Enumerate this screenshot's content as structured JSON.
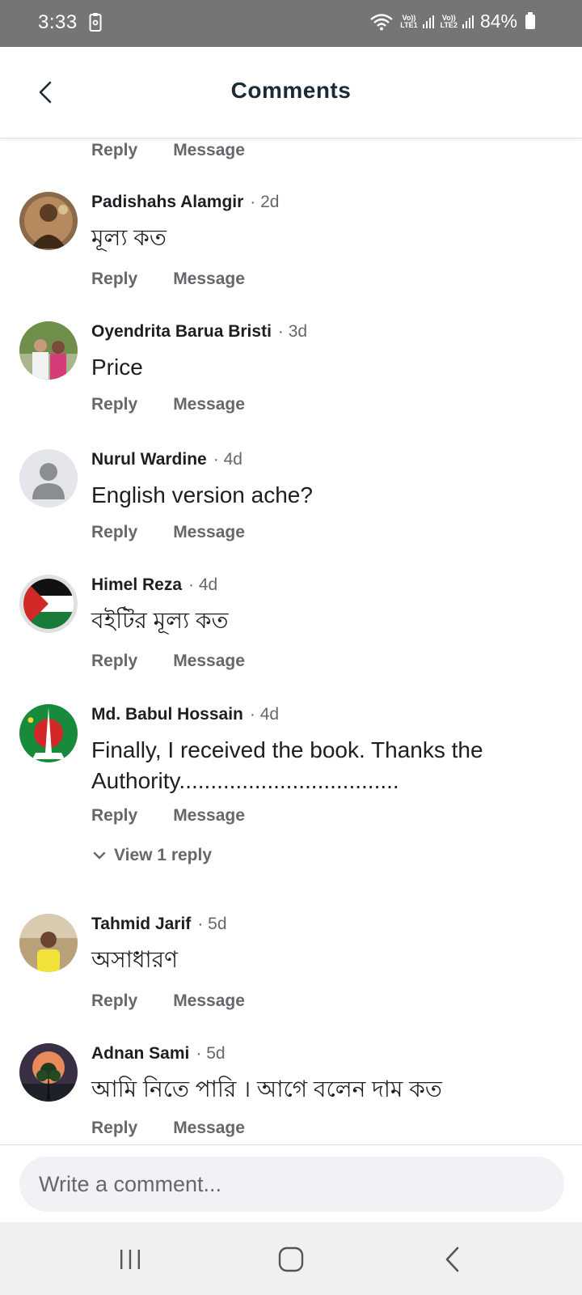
{
  "status_bar": {
    "time": "3:33",
    "sim1_label": "Vo))",
    "sim1_sub": "LTE1",
    "sim2_label": "Vo))",
    "sim2_sub": "LTE2",
    "battery": "84%"
  },
  "header": {
    "title": "Comments"
  },
  "actions": {
    "reply_label": "Reply",
    "message_label": "Message"
  },
  "comments": [
    {
      "name": "Padishahs Alamgir",
      "time": "2d",
      "text": "মূল্য কত"
    },
    {
      "name": "Oyendrita Barua Bristi",
      "time": "3d",
      "text": "Price"
    },
    {
      "name": "Nurul Wardine",
      "time": "4d",
      "text": "English version ache?"
    },
    {
      "name": "Himel Reza",
      "time": "4d",
      "text": "বইটির মূল্য কত"
    },
    {
      "name": "Md. Babul Hossain",
      "time": "4d",
      "text": "Finally, I received the book. Thanks the Authority...................................",
      "view_replies": "View 1 reply"
    },
    {
      "name": "Tahmid Jarif",
      "time": "5d",
      "text": "অসাধারণ"
    },
    {
      "name": "Adnan Sami",
      "time": "5d",
      "text": "আমি নিতে পারি । আগে বলেন দাম কত"
    }
  ],
  "composer": {
    "placeholder": "Write a comment..."
  },
  "icons": {
    "back": "chevron-left-icon",
    "recents": "recents-icon",
    "home": "home-icon",
    "nav_back": "nav-back-icon"
  },
  "colors": {
    "secondary_text": "#65676b",
    "status_bar": "#757575"
  }
}
